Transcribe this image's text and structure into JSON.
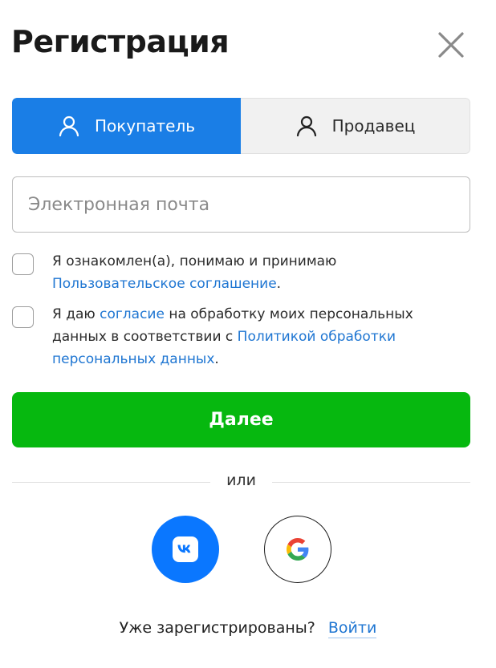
{
  "header": {
    "title": "Регистрация",
    "close_icon": "close-icon"
  },
  "tabs": [
    {
      "label": "Покупатель",
      "icon": "user-icon",
      "active": true
    },
    {
      "label": "Продавец",
      "icon": "user-icon",
      "active": false
    }
  ],
  "email": {
    "placeholder": "Электронная почта",
    "value": ""
  },
  "consents": {
    "agreement": {
      "checked": false,
      "text_before": "Я ознакомлен(а), понимаю и принимаю ",
      "link": "Пользовательское соглашение",
      "text_after": "."
    },
    "personal_data": {
      "checked": false,
      "text_before": "Я даю ",
      "link1": "согласие",
      "text_middle": " на обработку моих персональных данных в соответствии с ",
      "link2": "Политикой обработки персональных данных",
      "text_after": "."
    }
  },
  "next_button": {
    "label": "Далее"
  },
  "divider": {
    "label": "или"
  },
  "social": [
    {
      "name": "vk",
      "icon": "vk-icon"
    },
    {
      "name": "google",
      "icon": "google-icon"
    }
  ],
  "footer": {
    "question": "Уже зарегистрированы?",
    "login_link": "Войти"
  },
  "colors": {
    "primary_blue": "#1a7ee6",
    "link_blue": "#1f76d2",
    "green_button": "#06b80f",
    "vk_blue": "#0a77ff"
  }
}
